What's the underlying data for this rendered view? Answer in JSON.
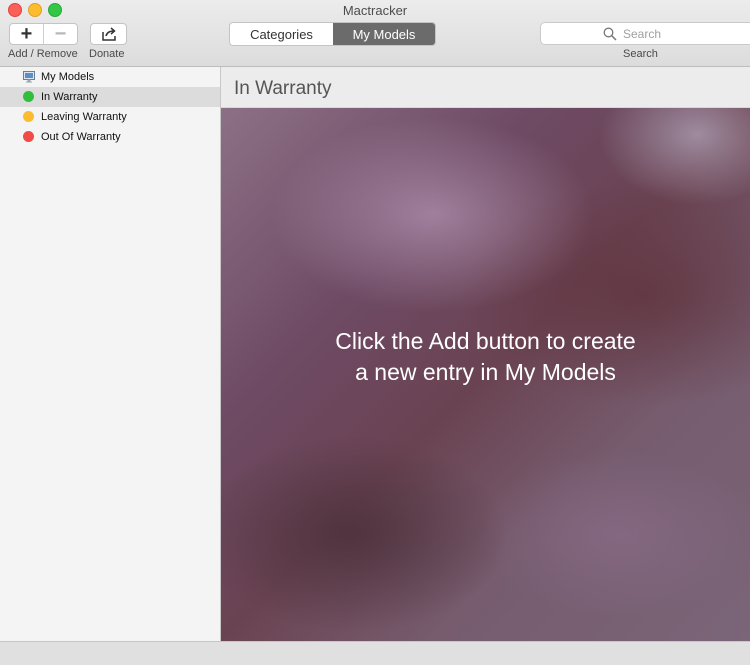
{
  "window": {
    "title": "Mactracker"
  },
  "toolbar": {
    "add_remove_label": "Add / Remove",
    "donate_label": "Donate",
    "search_label": "Search",
    "search_placeholder": "Search",
    "segments": {
      "categories": "Categories",
      "my_models": "My Models",
      "selected": "My Models"
    }
  },
  "sidebar": {
    "items": [
      {
        "label": "My Models",
        "icon": "mac-icon"
      },
      {
        "label": "In Warranty",
        "icon": "green-dot-icon",
        "color": "#2fbf3b",
        "selected": true
      },
      {
        "label": "Leaving Warranty",
        "icon": "yellow-dot-icon",
        "color": "#fbbd2f"
      },
      {
        "label": "Out Of Warranty",
        "icon": "red-dot-icon",
        "color": "#f14a47"
      }
    ]
  },
  "main": {
    "title": "In Warranty",
    "empty_message_line1": "Click the Add button to create",
    "empty_message_line2": "a new entry in My Models"
  }
}
